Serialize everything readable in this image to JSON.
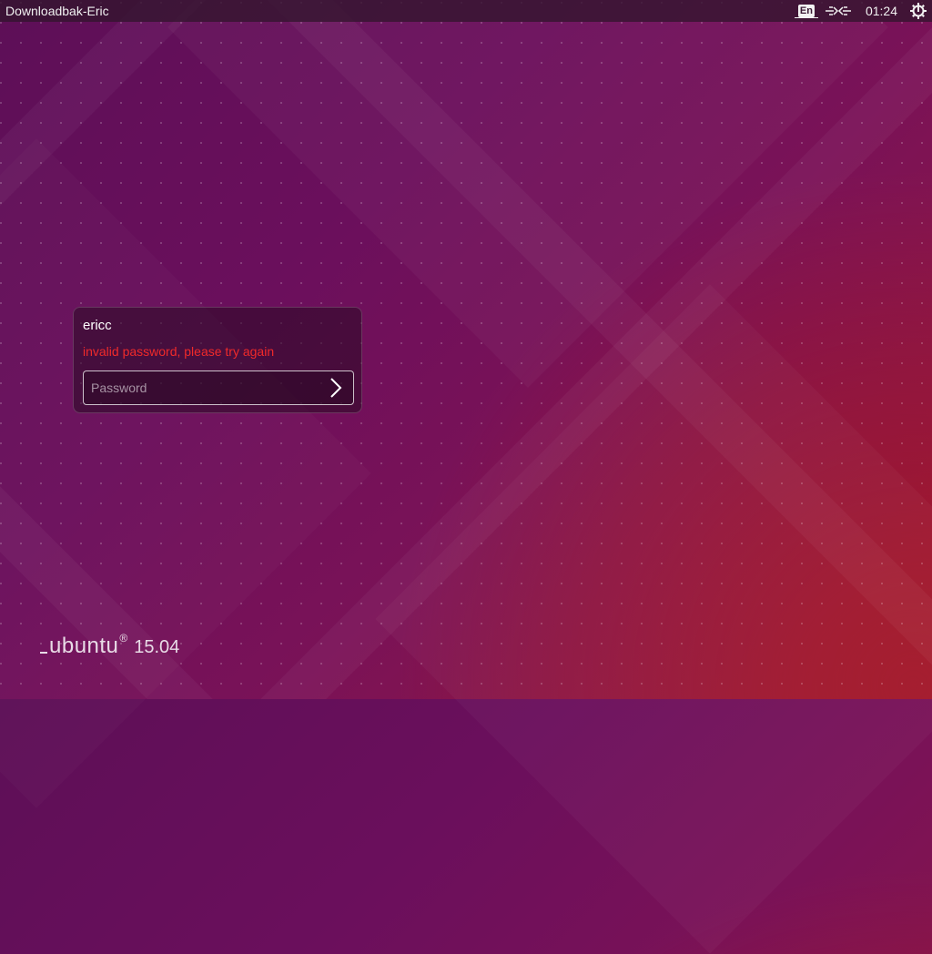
{
  "top_panel": {
    "hostname": "Downloadbak-Eric",
    "keyboard_layout": "En",
    "network_icon": "network-wired-icon",
    "clock": "01:24",
    "power_icon": "power-gear-icon"
  },
  "login": {
    "username": "ericc",
    "error": "invalid password, please try again",
    "password_placeholder": "Password",
    "submit_icon": "chevron-right-icon"
  },
  "branding": {
    "name": "ubuntu",
    "registered": "®",
    "version": "15.04"
  },
  "colors": {
    "background_start": "#5d0f57",
    "background_end": "#a21a2a",
    "error_text": "#f02a2a"
  }
}
